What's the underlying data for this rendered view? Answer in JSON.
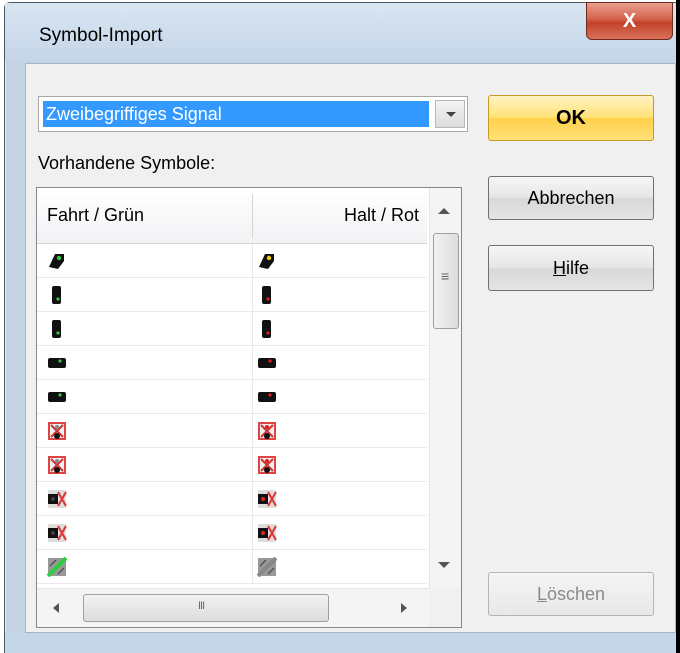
{
  "window": {
    "title": "Symbol-Import",
    "close_glyph": "X"
  },
  "combo": {
    "selected": "Zweibegriffiges Signal"
  },
  "list": {
    "label": "Vorhandene Symbole:",
    "columns": [
      "Fahrt / Grün",
      "Halt / Rot"
    ],
    "scrollbar_glyph_v": "≡",
    "scrollbar_glyph_h": "III"
  },
  "symbols": [
    {
      "a": "signal-head-green",
      "b": "signal-head-yellow"
    },
    {
      "a": "signal-mast-green",
      "b": "signal-mast-red"
    },
    {
      "a": "signal-mast-green",
      "b": "signal-mast-red"
    },
    {
      "a": "signal-block-green",
      "b": "signal-block-red"
    },
    {
      "a": "signal-block-green",
      "b": "signal-block-red"
    },
    {
      "a": "crossing-sign",
      "b": "crossing-sign-red"
    },
    {
      "a": "crossing-sign",
      "b": "crossing-sign-red"
    },
    {
      "a": "crossing-block",
      "b": "crossing-block-red"
    },
    {
      "a": "crossing-block",
      "b": "crossing-block-red"
    },
    {
      "a": "diagonal-track-green",
      "b": "diagonal-track-gray"
    }
  ],
  "buttons": {
    "ok": "OK",
    "cancel": "Abbrechen",
    "help_first": "H",
    "help_rest": "ilfe",
    "delete_first": "L",
    "delete_rest": "öschen"
  },
  "colors": {
    "selection": "#3399ff",
    "ok_button": "#ffd24a",
    "close_button": "#c2412a",
    "signal_green": "#2ecc40",
    "signal_red": "#e02020",
    "signal_yellow": "#f5d000"
  }
}
